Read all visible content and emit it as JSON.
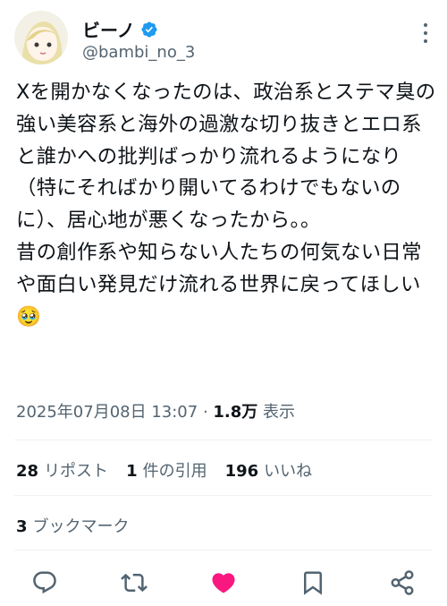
{
  "tweet": {
    "author_name": "ビーノ",
    "handle": "@bambi_no_3",
    "body": "Xを開かなくなったのは、政治系とステマ臭の強い美容系と海外の過激な切り抜きとエロ系と誰かへの批判ばっかり流れるようになり（特にそればかり開いてるわけでもないのに）、居心地が悪くなったから。。\n昔の創作系や知らない人たちの何気ない日常や面白い発見だけ流れる世界に戻ってほしい🥹",
    "datetime": "2025年07月08日 13:07",
    "views_count": "1.8万",
    "views_label": "表示"
  },
  "stats": {
    "reposts_count": "28",
    "reposts_label": "リポスト",
    "quotes_count": "1",
    "quotes_label": "件の引用",
    "likes_count": "196",
    "likes_label": "いいね",
    "bookmarks_count": "3",
    "bookmarks_label": "ブックマーク"
  },
  "icons": {
    "reply": "reply-icon",
    "repost": "repost-icon",
    "like": "heart-icon",
    "bookmark": "bookmark-icon",
    "share": "share-icon",
    "more": "more-icon",
    "verified": "verified-badge-icon"
  },
  "colors": {
    "text": "#0f1419",
    "secondary": "#536471",
    "verified": "#1d9bf0",
    "like": "#f91880"
  }
}
